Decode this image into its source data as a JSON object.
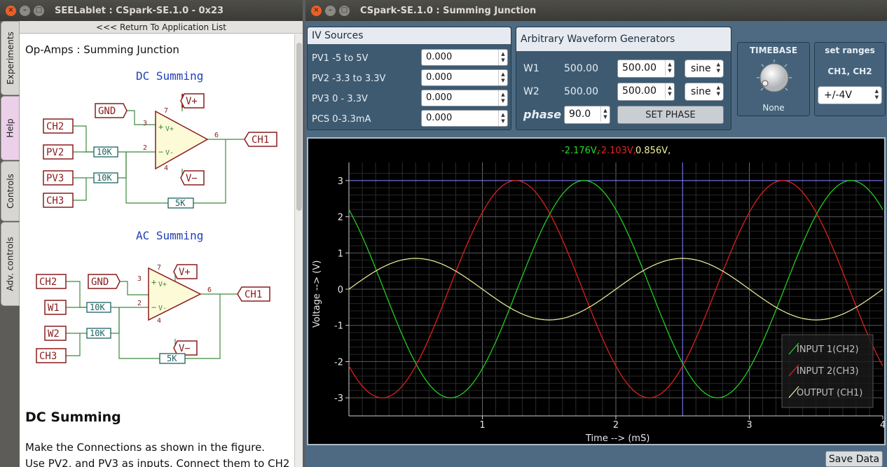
{
  "left_window": {
    "title": "SEELablet : CSpark-SE.1.0 - 0x23",
    "return_label": "<<< Return To Application List",
    "tabs": [
      "Experiments",
      "Help",
      "Controls",
      "Adv. controls"
    ]
  },
  "help": {
    "title": "Op-Amps : Summing Junction",
    "dc_title": "DC Summing",
    "ac_title": "AC Summing",
    "section_heading": "DC Summing",
    "para1": "Make the Connections as shown in the figure.",
    "para2": "Use PV2, and PV3 as inputs. Connect them to CH2",
    "dc_schematic": {
      "gnd": "GND",
      "vplus": "V+",
      "vminus": "V−",
      "out": "CH1",
      "in_a": "CH2",
      "in_b": "PV2",
      "in_c": "PV3",
      "in_d": "CH3",
      "r1": "10K",
      "r2": "10K",
      "rf": "5K",
      "pin3": "3",
      "pin2": "2",
      "pin6": "6",
      "pin7": "7",
      "pin4": "4",
      "plus": "+",
      "minus": "−"
    },
    "ac_schematic": {
      "gnd": "GND",
      "vplus": "V+",
      "vminus": "V−",
      "out": "CH1",
      "in_a": "CH2",
      "in_b": "W1",
      "in_c": "W2",
      "in_d": "CH3",
      "r1": "10K",
      "r2": "10K",
      "rf": "5K",
      "pin3": "3",
      "pin2": "2",
      "pin6": "6",
      "pin7": "7",
      "pin4": "4",
      "plus": "+",
      "minus": "−"
    }
  },
  "right_window": {
    "title": "CSpark-SE.1.0 : Summing Junction",
    "save_label": "Save Data"
  },
  "iv": {
    "title": "IV Sources",
    "rows": [
      {
        "label": "PV1  -5 to 5V",
        "value": "0.000"
      },
      {
        "label": "PV2  -3.3 to 3.3V",
        "value": "0.000"
      },
      {
        "label": "PV3  0 - 3.3V",
        "value": "0.000"
      },
      {
        "label": "PCS  0-3.3mA",
        "value": "0.000"
      }
    ]
  },
  "awg": {
    "title": "Arbitrary Waveform Generators",
    "w1_label": "W1",
    "w1_readout": "500.00",
    "w1_value": "500.00",
    "w1_shape": "sine",
    "w2_label": "W2",
    "w2_readout": "500.00",
    "w2_value": "500.00",
    "w2_shape": "sine",
    "phase_label": "phase",
    "phase_value": "90.0",
    "set_phase_label": "SET PHASE"
  },
  "timebase": {
    "title": "TIMEBASE",
    "value": "None"
  },
  "ranges": {
    "title": "set ranges",
    "channels": "CH1, CH2",
    "selected": "+/-4V"
  },
  "readout": {
    "ch2": "-2.176V,",
    "ch3": "-2.103V,",
    "ch1": "0.856V,"
  },
  "chart_data": {
    "type": "line",
    "xlabel": "Time --> (mS)",
    "ylabel": "Voltage --> (V)",
    "xlim": [
      0,
      4
    ],
    "ylim": [
      -3.5,
      3.5
    ],
    "xticks": [
      1,
      2,
      3,
      4
    ],
    "yticks": [
      3,
      2,
      1,
      0,
      -1,
      -2,
      -3
    ],
    "grid": true,
    "cursor_x": 2.5,
    "cursor_y": 3.0,
    "legend_position": "bottom-right",
    "series": [
      {
        "name": "INPUT 1(CH2)",
        "color": "#22dd22",
        "amplitude": 3.0,
        "frequency_khz": 0.5,
        "phase_deg": 133
      },
      {
        "name": "INPUT 2(CH3)",
        "color": "#ee2020",
        "amplitude": 3.0,
        "frequency_khz": 0.5,
        "phase_deg": 225
      },
      {
        "name": "OUTPUT (CH1)",
        "color": "#f2f2a0",
        "amplitude": 0.85,
        "frequency_khz": 0.5,
        "phase_deg": 0
      }
    ]
  },
  "colors": {
    "accent": "#4d6a82",
    "plot_bg": "#000000",
    "grid": "#555555",
    "cursor": "#7a7aff"
  }
}
